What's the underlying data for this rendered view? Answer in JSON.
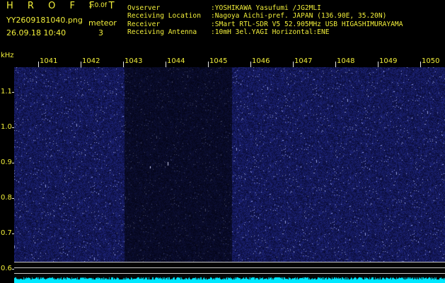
{
  "header": {
    "app_title": "H R O F F T",
    "app_version": "1.0.0f",
    "file_name": "YY2609181040.png",
    "timestamp": "26.09.18 10:40",
    "mode_label": "meteor",
    "count_value": "3"
  },
  "station_info": [
    {
      "label": "Ovserver",
      "value": ":YOSHIKAWA Yasufumi /JG2MLI"
    },
    {
      "label": "Receiving Location",
      "value": ":Nagoya Aichi-pref. JAPAN (136.90E, 35.20N)"
    },
    {
      "label": "Receiver",
      "value": ":SMart RTL-SDR V5 52.905MHz USB HIGASHIMURAYAMA"
    },
    {
      "label": "Receiving Antenna",
      "value": ":10mH 3el.YAGI Horizontal:ENE"
    }
  ],
  "axes": {
    "y_unit": "kHz",
    "x_ticks": [
      "1041",
      "1042",
      "1043",
      "1044",
      "1045",
      "1046",
      "1047",
      "1048",
      "1049",
      "1050"
    ],
    "y_ticks": [
      "1.1",
      "1.0",
      "0.9",
      "0.8",
      "0.7",
      "0.6"
    ]
  },
  "colors": {
    "text": "#f2ef3a",
    "background": "#000000",
    "noise_base": "#1a1d78",
    "trace": "#00ffff"
  }
}
